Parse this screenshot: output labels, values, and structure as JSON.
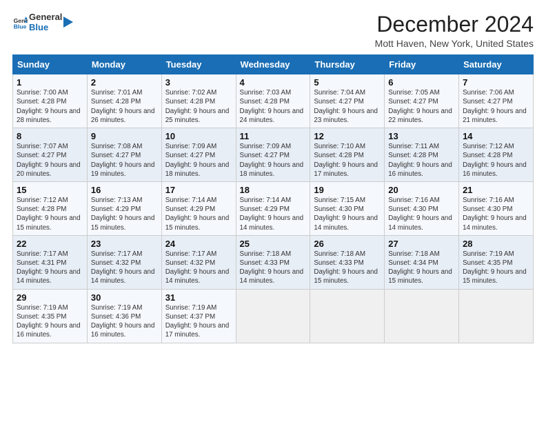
{
  "logo": {
    "line1": "General",
    "line2": "Blue"
  },
  "title": "December 2024",
  "subtitle": "Mott Haven, New York, United States",
  "days_of_week": [
    "Sunday",
    "Monday",
    "Tuesday",
    "Wednesday",
    "Thursday",
    "Friday",
    "Saturday"
  ],
  "weeks": [
    [
      {
        "day": "1",
        "sunrise": "Sunrise: 7:00 AM",
        "sunset": "Sunset: 4:28 PM",
        "daylight": "Daylight: 9 hours and 28 minutes."
      },
      {
        "day": "2",
        "sunrise": "Sunrise: 7:01 AM",
        "sunset": "Sunset: 4:28 PM",
        "daylight": "Daylight: 9 hours and 26 minutes."
      },
      {
        "day": "3",
        "sunrise": "Sunrise: 7:02 AM",
        "sunset": "Sunset: 4:28 PM",
        "daylight": "Daylight: 9 hours and 25 minutes."
      },
      {
        "day": "4",
        "sunrise": "Sunrise: 7:03 AM",
        "sunset": "Sunset: 4:28 PM",
        "daylight": "Daylight: 9 hours and 24 minutes."
      },
      {
        "day": "5",
        "sunrise": "Sunrise: 7:04 AM",
        "sunset": "Sunset: 4:27 PM",
        "daylight": "Daylight: 9 hours and 23 minutes."
      },
      {
        "day": "6",
        "sunrise": "Sunrise: 7:05 AM",
        "sunset": "Sunset: 4:27 PM",
        "daylight": "Daylight: 9 hours and 22 minutes."
      },
      {
        "day": "7",
        "sunrise": "Sunrise: 7:06 AM",
        "sunset": "Sunset: 4:27 PM",
        "daylight": "Daylight: 9 hours and 21 minutes."
      }
    ],
    [
      {
        "day": "8",
        "sunrise": "Sunrise: 7:07 AM",
        "sunset": "Sunset: 4:27 PM",
        "daylight": "Daylight: 9 hours and 20 minutes."
      },
      {
        "day": "9",
        "sunrise": "Sunrise: 7:08 AM",
        "sunset": "Sunset: 4:27 PM",
        "daylight": "Daylight: 9 hours and 19 minutes."
      },
      {
        "day": "10",
        "sunrise": "Sunrise: 7:09 AM",
        "sunset": "Sunset: 4:27 PM",
        "daylight": "Daylight: 9 hours and 18 minutes."
      },
      {
        "day": "11",
        "sunrise": "Sunrise: 7:09 AM",
        "sunset": "Sunset: 4:27 PM",
        "daylight": "Daylight: 9 hours and 18 minutes."
      },
      {
        "day": "12",
        "sunrise": "Sunrise: 7:10 AM",
        "sunset": "Sunset: 4:28 PM",
        "daylight": "Daylight: 9 hours and 17 minutes."
      },
      {
        "day": "13",
        "sunrise": "Sunrise: 7:11 AM",
        "sunset": "Sunset: 4:28 PM",
        "daylight": "Daylight: 9 hours and 16 minutes."
      },
      {
        "day": "14",
        "sunrise": "Sunrise: 7:12 AM",
        "sunset": "Sunset: 4:28 PM",
        "daylight": "Daylight: 9 hours and 16 minutes."
      }
    ],
    [
      {
        "day": "15",
        "sunrise": "Sunrise: 7:12 AM",
        "sunset": "Sunset: 4:28 PM",
        "daylight": "Daylight: 9 hours and 15 minutes."
      },
      {
        "day": "16",
        "sunrise": "Sunrise: 7:13 AM",
        "sunset": "Sunset: 4:29 PM",
        "daylight": "Daylight: 9 hours and 15 minutes."
      },
      {
        "day": "17",
        "sunrise": "Sunrise: 7:14 AM",
        "sunset": "Sunset: 4:29 PM",
        "daylight": "Daylight: 9 hours and 15 minutes."
      },
      {
        "day": "18",
        "sunrise": "Sunrise: 7:14 AM",
        "sunset": "Sunset: 4:29 PM",
        "daylight": "Daylight: 9 hours and 14 minutes."
      },
      {
        "day": "19",
        "sunrise": "Sunrise: 7:15 AM",
        "sunset": "Sunset: 4:30 PM",
        "daylight": "Daylight: 9 hours and 14 minutes."
      },
      {
        "day": "20",
        "sunrise": "Sunrise: 7:16 AM",
        "sunset": "Sunset: 4:30 PM",
        "daylight": "Daylight: 9 hours and 14 minutes."
      },
      {
        "day": "21",
        "sunrise": "Sunrise: 7:16 AM",
        "sunset": "Sunset: 4:30 PM",
        "daylight": "Daylight: 9 hours and 14 minutes."
      }
    ],
    [
      {
        "day": "22",
        "sunrise": "Sunrise: 7:17 AM",
        "sunset": "Sunset: 4:31 PM",
        "daylight": "Daylight: 9 hours and 14 minutes."
      },
      {
        "day": "23",
        "sunrise": "Sunrise: 7:17 AM",
        "sunset": "Sunset: 4:32 PM",
        "daylight": "Daylight: 9 hours and 14 minutes."
      },
      {
        "day": "24",
        "sunrise": "Sunrise: 7:17 AM",
        "sunset": "Sunset: 4:32 PM",
        "daylight": "Daylight: 9 hours and 14 minutes."
      },
      {
        "day": "25",
        "sunrise": "Sunrise: 7:18 AM",
        "sunset": "Sunset: 4:33 PM",
        "daylight": "Daylight: 9 hours and 14 minutes."
      },
      {
        "day": "26",
        "sunrise": "Sunrise: 7:18 AM",
        "sunset": "Sunset: 4:33 PM",
        "daylight": "Daylight: 9 hours and 15 minutes."
      },
      {
        "day": "27",
        "sunrise": "Sunrise: 7:18 AM",
        "sunset": "Sunset: 4:34 PM",
        "daylight": "Daylight: 9 hours and 15 minutes."
      },
      {
        "day": "28",
        "sunrise": "Sunrise: 7:19 AM",
        "sunset": "Sunset: 4:35 PM",
        "daylight": "Daylight: 9 hours and 15 minutes."
      }
    ],
    [
      {
        "day": "29",
        "sunrise": "Sunrise: 7:19 AM",
        "sunset": "Sunset: 4:35 PM",
        "daylight": "Daylight: 9 hours and 16 minutes."
      },
      {
        "day": "30",
        "sunrise": "Sunrise: 7:19 AM",
        "sunset": "Sunset: 4:36 PM",
        "daylight": "Daylight: 9 hours and 16 minutes."
      },
      {
        "day": "31",
        "sunrise": "Sunrise: 7:19 AM",
        "sunset": "Sunset: 4:37 PM",
        "daylight": "Daylight: 9 hours and 17 minutes."
      },
      null,
      null,
      null,
      null
    ]
  ]
}
